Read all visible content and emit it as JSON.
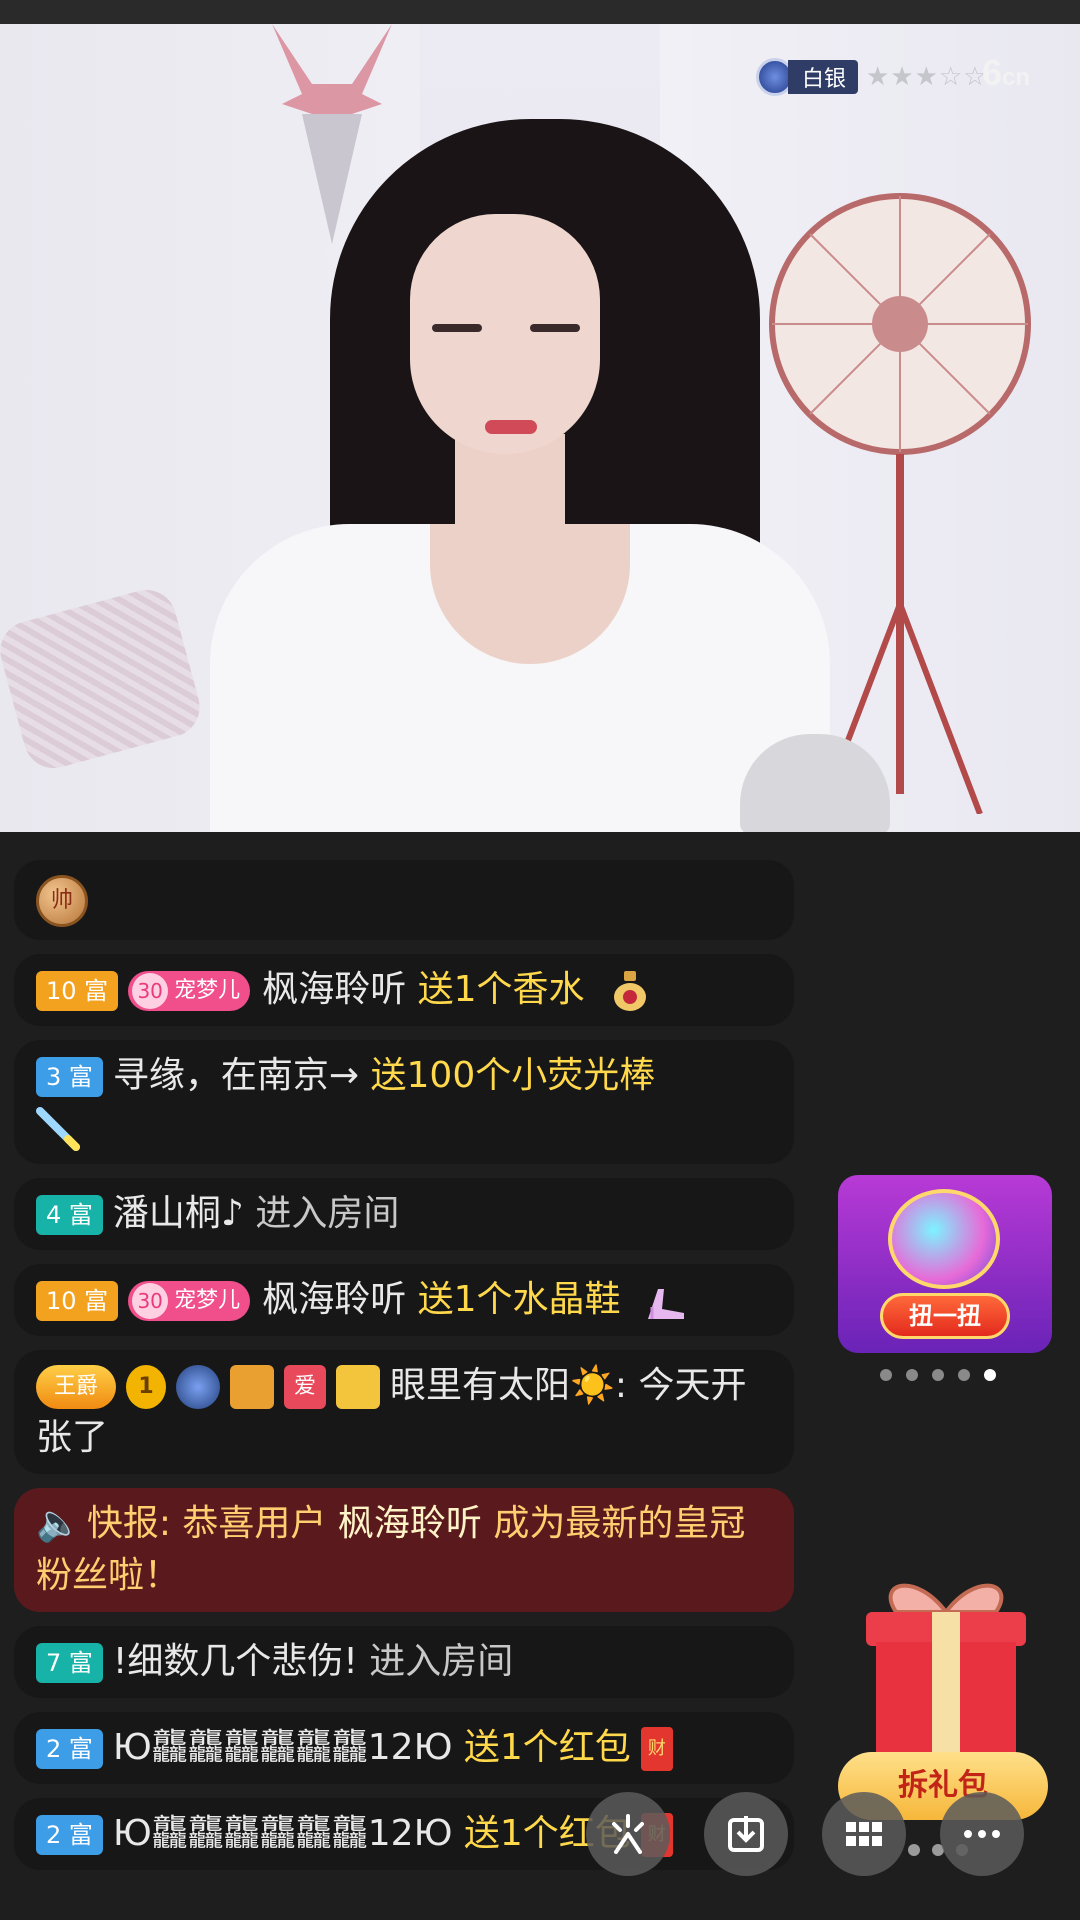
{
  "stream": {
    "anchor_level": "白银",
    "level_stars": "★★★☆☆",
    "site_logo_main": "6",
    "site_logo_sub": "cn"
  },
  "chat": {
    "first_badge": "帅",
    "messages": [
      {
        "fortune": "10 富",
        "pet": "宠梦儿",
        "pet_level": "30",
        "user": "枫海聆听",
        "action": "送1个香水"
      },
      {
        "fortune": "3 富",
        "user": "寻缘，在南京→",
        "action": "送100个小荧光棒"
      },
      {
        "fortune": "4 富",
        "user": "潘山桐♪",
        "action": "进入房间"
      },
      {
        "fortune": "10 富",
        "pet": "宠梦儿",
        "pet_level": "30",
        "user": "枫海聆听",
        "action": "送1个水晶鞋"
      },
      {
        "tag_king": "王爵",
        "tag_one": "1",
        "tag_love": "爱",
        "user": "眼里有太阳",
        "sun": "☀️",
        "text": ": 今天开张了"
      },
      {
        "flash_label": "快报:",
        "flash_text_a": "恭喜用户",
        "flash_user": "枫海聆听",
        "flash_text_b": "成为最新的皇冠粉丝啦！"
      },
      {
        "fortune": "7 富",
        "user": "!细数几个悲伤!",
        "action": "进入房间"
      },
      {
        "fortune": "2 富",
        "user": "Ю龘龘龘龘龘龘12Ю",
        "action": "送1个红包",
        "envelope": "财"
      },
      {
        "fortune": "2 富",
        "user": "Ю龘龘龘龘龘龘12Ю",
        "action": "送1个红包",
        "envelope": "财"
      }
    ]
  },
  "widgets": {
    "spin_label": "扭一扭",
    "gift_label": "拆礼包"
  },
  "colors": {
    "gift_text": "#ffd84b",
    "fortune_orange": "#f3a21f",
    "fortune_blue": "#3d9de6",
    "fortune_teal": "#18b3a8",
    "flash_bg": "#5a1a1d"
  }
}
